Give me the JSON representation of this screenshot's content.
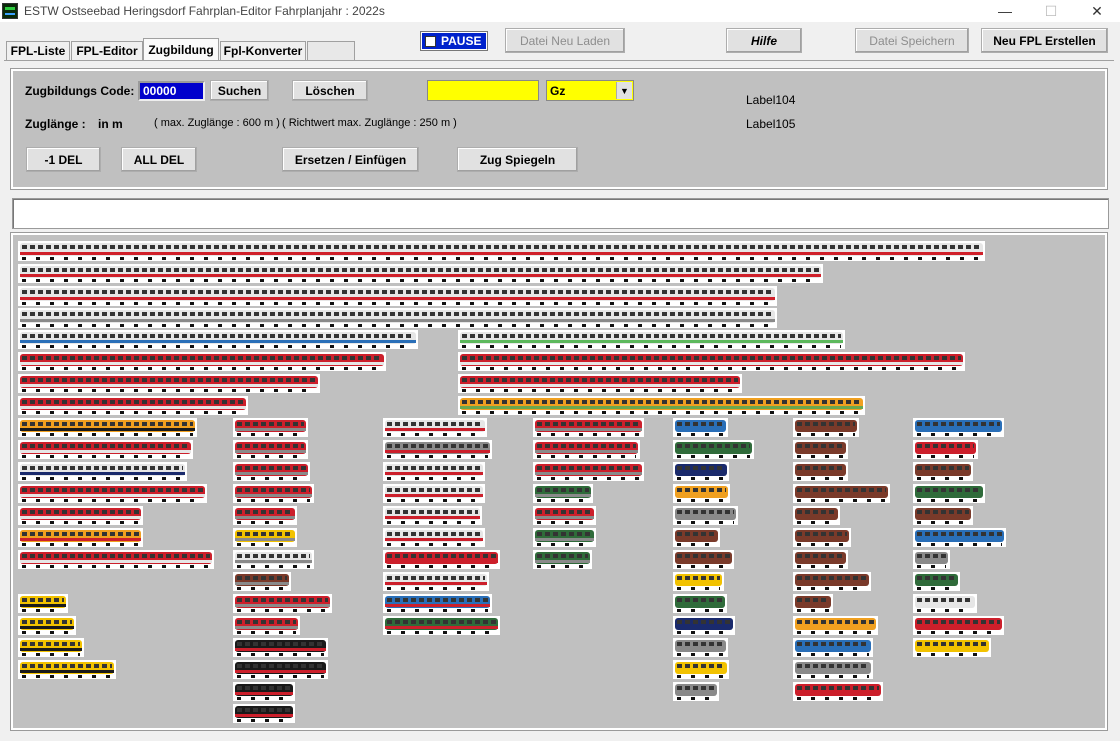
{
  "window": {
    "title": "ESTW Ostseebad Heringsdorf  Fahrplan-Editor    Fahrplanjahr : 2022s",
    "minimize_glyph": "—",
    "maximize_glyph": "☐",
    "close_glyph": "✕"
  },
  "tabs": [
    {
      "label": "FPL-Liste"
    },
    {
      "label": "FPL-Editor"
    },
    {
      "label": "Zugbildung"
    },
    {
      "label": "Fpl-Konverter"
    },
    {
      "label": ""
    }
  ],
  "toolbar": {
    "pause_label": "PAUSE",
    "reload_label": "Datei Neu Laden",
    "help_label": "Hilfe",
    "save_label": "Datei Speichern",
    "new_fpl_label": "Neu FPL Erstellen"
  },
  "form": {
    "code_label": "Zugbildungs Code:",
    "code_value": "00000",
    "search_label": "Suchen",
    "delete_label": "Löschen",
    "train_type_value": "Gz",
    "label104": "Label104",
    "label105": "Label105",
    "length_label": "Zuglänge :",
    "length_unit": "in m",
    "max_length_note": "( max. Zuglänge : 600 m )",
    "guide_length_note": "( Richtwert max. Zuglänge : 250 m )",
    "del_one_label": "-1 DEL",
    "del_all_label": "ALL DEL",
    "replace_insert_label": "Ersetzen / Einfügen",
    "mirror_label": "Zug Spiegeln"
  },
  "message": "",
  "palette": {
    "ice_white": "#e6e6e6",
    "ice_red": "#d0202a",
    "db_red": "#cc1f2b",
    "regio_blue": "#2a6fb8",
    "regio_green": "#5cb85c",
    "odeg_orange": "#f0a020",
    "odeg_green": "#6aa84f",
    "navy": "#1a2a6c",
    "freight_brown": "#7a3a2a",
    "freight_green": "#2f6b3a",
    "yellow": "#f2c200",
    "grey": "#8a8a8a",
    "black": "#1a1a1a"
  }
}
